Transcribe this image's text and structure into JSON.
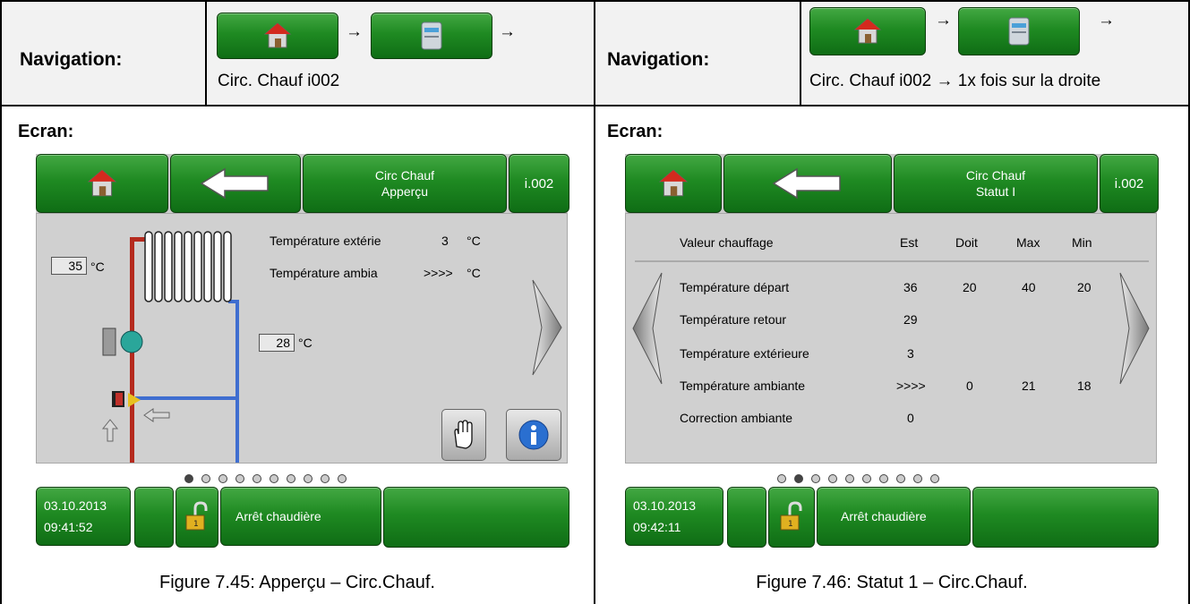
{
  "left": {
    "navigation_label": "Navigation:",
    "nav_text": "Circ. Chauf i002",
    "arrow1": "→",
    "arrow2": "→",
    "ecran_label": "Ecran:",
    "screen": {
      "title_line1": "Circ Chauf",
      "title_line2": "Apperçu",
      "id": "i.002",
      "outside_temp_label": "Température extérie",
      "outside_temp_value": "3",
      "outside_temp_unit": "°C",
      "room_temp_label": "Température ambia",
      "room_temp_value": ">>>>",
      "room_temp_unit": "°C",
      "flow_value": "35",
      "flow_unit": "°C",
      "return_value": "28",
      "return_unit": "°C",
      "date": "03.10.2013",
      "time": "09:41:52",
      "status": "Arrêt chaudière",
      "page_dots": 10,
      "active_dot": 0
    },
    "caption": "Figure 7.45: Apperçu – Circ.Chauf."
  },
  "right": {
    "navigation_label": "Navigation:",
    "nav_text": "Circ. Chauf i002 → 1x fois sur la droite",
    "arrow1": "→",
    "arrow2": "→",
    "ecran_label": "Ecran:",
    "screen": {
      "title_line1": "Circ Chauf",
      "title_line2": "Statut I",
      "id": "i.002",
      "headers": [
        "Valeur chauffage",
        "Est",
        "Doit",
        "Max",
        "Min"
      ],
      "rows": [
        [
          "Température départ",
          "36",
          "20",
          "40",
          "20"
        ],
        [
          "Température retour",
          "29",
          "",
          "",
          ""
        ],
        [
          "Température extérieure",
          "3",
          "",
          "",
          ""
        ],
        [
          "Température ambiante",
          ">>>>",
          "0",
          "21",
          "18"
        ],
        [
          "Correction ambiante",
          "0",
          "",
          "",
          ""
        ]
      ],
      "date": "03.10.2013",
      "time": "09:42:11",
      "status": "Arrêt chaudière",
      "page_dots": 10,
      "active_dot": 1
    },
    "caption": "Figure 7.46: Statut 1 – Circ.Chauf."
  }
}
